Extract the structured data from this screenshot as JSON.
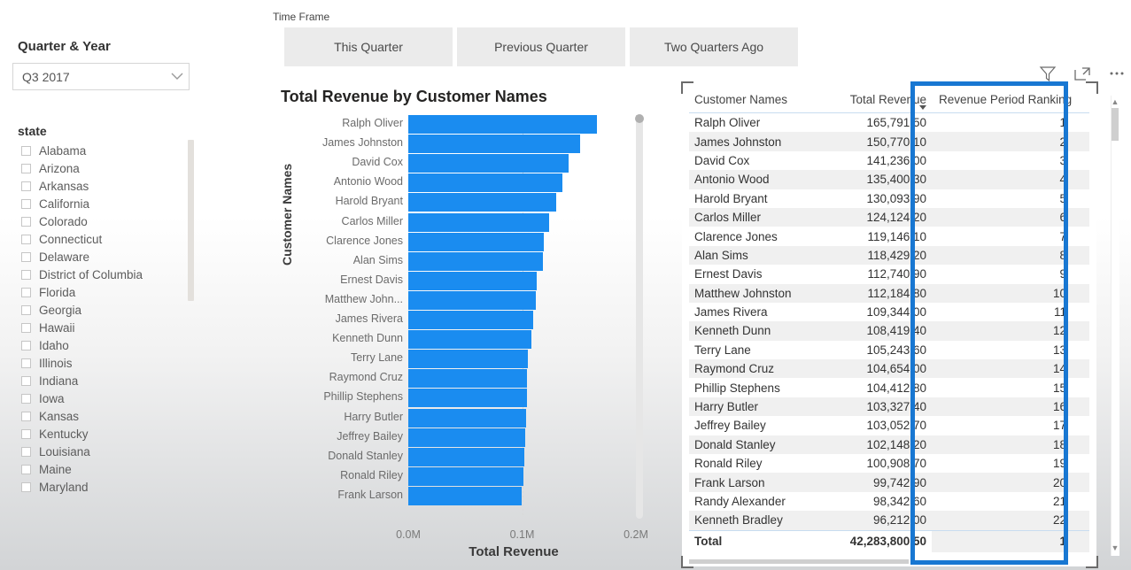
{
  "slicers": {
    "quarter": {
      "label": "Quarter & Year",
      "selected": "Q3 2017",
      "chevron_icon": "chevron-down-icon"
    },
    "state": {
      "label": "state",
      "items": [
        "Alabama",
        "Arizona",
        "Arkansas",
        "California",
        "Colorado",
        "Connecticut",
        "Delaware",
        "District of Columbia",
        "Florida",
        "Georgia",
        "Hawaii",
        "Idaho",
        "Illinois",
        "Indiana",
        "Iowa",
        "Kansas",
        "Kentucky",
        "Louisiana",
        "Maine",
        "Maryland"
      ]
    },
    "time_frame": {
      "label": "Time Frame",
      "buttons": [
        "This Quarter",
        "Previous Quarter",
        "Two Quarters Ago"
      ]
    }
  },
  "visual_header": {
    "filter_icon": "filter-funnel-icon",
    "focus_icon": "focus-mode-icon",
    "more_icon": "more-options-icon"
  },
  "table": {
    "columns": [
      "Customer Names",
      "Total Revenue",
      "Revenue Period Ranking"
    ],
    "rows": [
      {
        "name": "Ralph Oliver",
        "revenue": "165,791.50",
        "rank": "1"
      },
      {
        "name": "James Johnston",
        "revenue": "150,770.10",
        "rank": "2"
      },
      {
        "name": "David Cox",
        "revenue": "141,236.00",
        "rank": "3"
      },
      {
        "name": "Antonio Wood",
        "revenue": "135,400.30",
        "rank": "4"
      },
      {
        "name": "Harold Bryant",
        "revenue": "130,093.90",
        "rank": "5"
      },
      {
        "name": "Carlos Miller",
        "revenue": "124,124.20",
        "rank": "6"
      },
      {
        "name": "Clarence Jones",
        "revenue": "119,146.10",
        "rank": "7"
      },
      {
        "name": "Alan Sims",
        "revenue": "118,429.20",
        "rank": "8"
      },
      {
        "name": "Ernest Davis",
        "revenue": "112,740.90",
        "rank": "9"
      },
      {
        "name": "Matthew Johnston",
        "revenue": "112,184.80",
        "rank": "10"
      },
      {
        "name": "James Rivera",
        "revenue": "109,344.00",
        "rank": "11"
      },
      {
        "name": "Kenneth Dunn",
        "revenue": "108,419.40",
        "rank": "12"
      },
      {
        "name": "Terry Lane",
        "revenue": "105,243.60",
        "rank": "13"
      },
      {
        "name": "Raymond Cruz",
        "revenue": "104,654.00",
        "rank": "14"
      },
      {
        "name": "Phillip Stephens",
        "revenue": "104,412.80",
        "rank": "15"
      },
      {
        "name": "Harry Butler",
        "revenue": "103,327.40",
        "rank": "16"
      },
      {
        "name": "Jeffrey Bailey",
        "revenue": "103,052.70",
        "rank": "17"
      },
      {
        "name": "Donald Stanley",
        "revenue": "102,148.20",
        "rank": "18"
      },
      {
        "name": "Ronald Riley",
        "revenue": "100,908.70",
        "rank": "19"
      },
      {
        "name": "Frank Larson",
        "revenue": "99,742.90",
        "rank": "20"
      },
      {
        "name": "Randy Alexander",
        "revenue": "98,342.60",
        "rank": "21"
      },
      {
        "name": "Kenneth Bradley",
        "revenue": "96,212.00",
        "rank": "22"
      }
    ],
    "total_row": {
      "label": "Total",
      "revenue": "42,283,800.50",
      "rank": "1"
    },
    "sorted_by": "Total Revenue",
    "highlight_color": "#1877d2"
  },
  "chart_data": {
    "type": "bar",
    "title": "Total Revenue by Customer Names",
    "xlabel": "Total Revenue",
    "ylabel": "Customer Names",
    "orientation": "horizontal",
    "xlim": [
      0,
      200000
    ],
    "xticks": [
      "0.0M",
      "0.1M",
      "0.2M"
    ],
    "xtick_values": [
      0,
      100000,
      200000
    ],
    "grid": true,
    "bar_color": "#1a8cf0",
    "categories": [
      "Ralph Oliver",
      "James Johnston",
      "David Cox",
      "Antonio Wood",
      "Harold Bryant",
      "Carlos Miller",
      "Clarence Jones",
      "Alan Sims",
      "Ernest Davis",
      "Matthew John...",
      "James Rivera",
      "Kenneth Dunn",
      "Terry Lane",
      "Raymond Cruz",
      "Phillip Stephens",
      "Harry Butler",
      "Jeffrey Bailey",
      "Donald Stanley",
      "Ronald Riley",
      "Frank Larson"
    ],
    "values": [
      165791.5,
      150770.1,
      141236.0,
      135400.3,
      130093.9,
      124124.2,
      119146.1,
      118429.2,
      112740.9,
      112184.8,
      109344.0,
      108419.4,
      105243.6,
      104654.0,
      104412.8,
      103327.4,
      103052.7,
      102148.2,
      100908.7,
      99742.9
    ]
  }
}
